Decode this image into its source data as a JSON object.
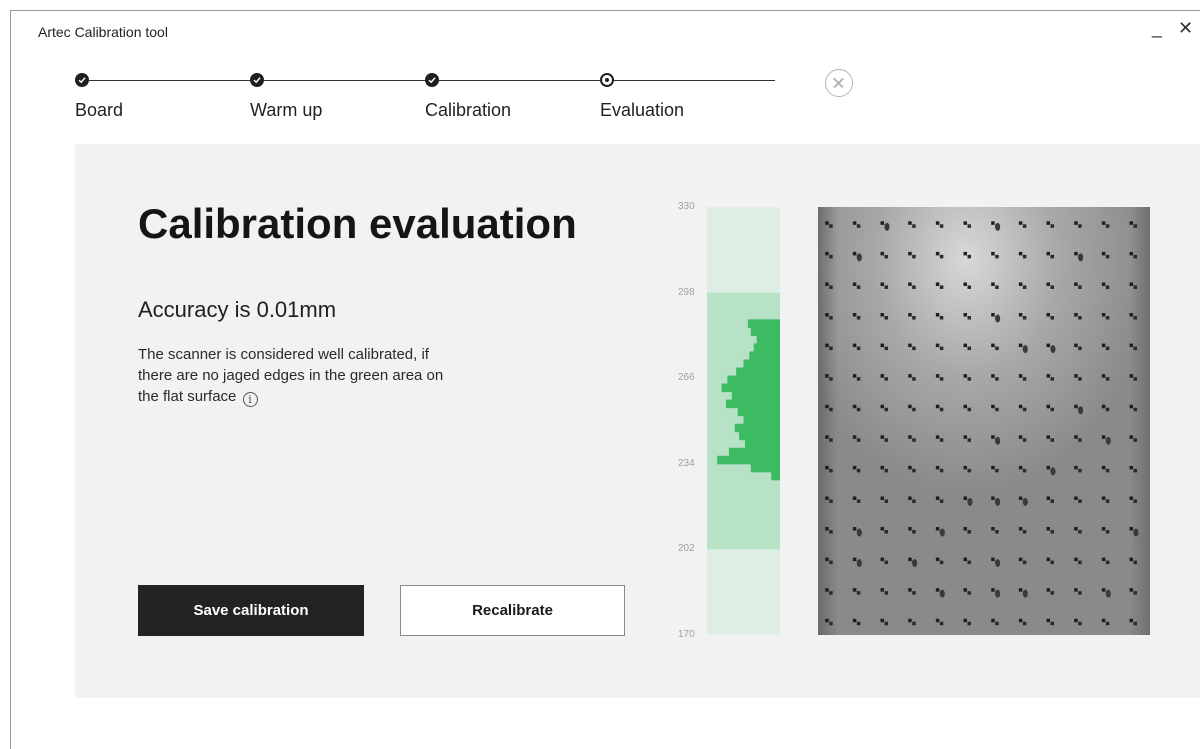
{
  "window": {
    "title": "Artec Calibration tool",
    "minimize": "_",
    "close": "✕"
  },
  "stepper": {
    "steps": [
      {
        "label": "Board",
        "state": "done"
      },
      {
        "label": "Warm up",
        "state": "done"
      },
      {
        "label": "Calibration",
        "state": "done"
      },
      {
        "label": "Evaluation",
        "state": "current"
      }
    ],
    "cancel_icon": "close-circle-icon"
  },
  "main": {
    "heading": "Calibration evaluation",
    "accuracy": "Accuracy is 0.01mm",
    "description": "The scanner is considered well calibrated, if there are no jaged edges in the green area on the flat surface",
    "info_glyph": "i",
    "save_label": "Save calibration",
    "recalibrate_label": "Recalibrate"
  },
  "histogram": {
    "tick_labels": [
      "330",
      "298",
      "266",
      "234",
      "202",
      "170"
    ],
    "range": [
      170,
      330
    ],
    "green_band": [
      202,
      298
    ],
    "colors": {
      "outer": "#deeee4",
      "band": "#b8e2c6",
      "bars": "#3dbb63"
    },
    "bins": [
      {
        "from": 288,
        "to": 285,
        "len": 0.44
      },
      {
        "from": 285,
        "to": 282,
        "len": 0.4
      },
      {
        "from": 282,
        "to": 279,
        "len": 0.32
      },
      {
        "from": 279,
        "to": 276,
        "len": 0.36
      },
      {
        "from": 276,
        "to": 273,
        "len": 0.42
      },
      {
        "from": 273,
        "to": 270,
        "len": 0.5
      },
      {
        "from": 270,
        "to": 267,
        "len": 0.6
      },
      {
        "from": 267,
        "to": 264,
        "len": 0.72
      },
      {
        "from": 264,
        "to": 261,
        "len": 0.8
      },
      {
        "from": 261,
        "to": 258,
        "len": 0.66
      },
      {
        "from": 258,
        "to": 255,
        "len": 0.74
      },
      {
        "from": 255,
        "to": 252,
        "len": 0.58
      },
      {
        "from": 252,
        "to": 249,
        "len": 0.5
      },
      {
        "from": 249,
        "to": 246,
        "len": 0.62
      },
      {
        "from": 246,
        "to": 243,
        "len": 0.56
      },
      {
        "from": 243,
        "to": 240,
        "len": 0.48
      },
      {
        "from": 240,
        "to": 237,
        "len": 0.7
      },
      {
        "from": 237,
        "to": 234,
        "len": 0.86
      },
      {
        "from": 234,
        "to": 231,
        "len": 0.4
      },
      {
        "from": 231,
        "to": 228,
        "len": 0.12
      }
    ]
  },
  "scan_image": {
    "rows": 14,
    "cols": 12
  }
}
